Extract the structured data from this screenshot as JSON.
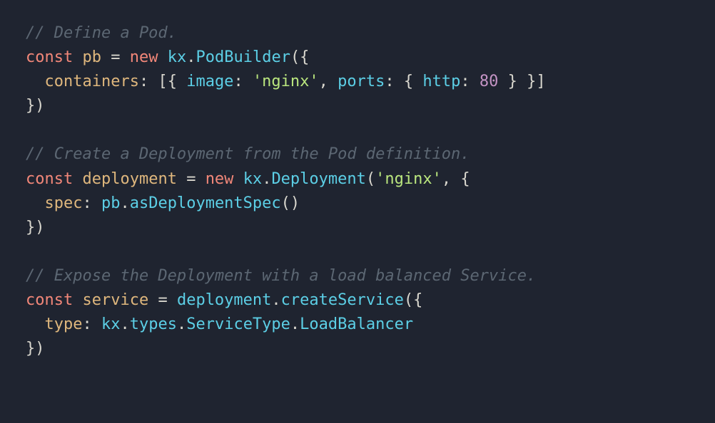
{
  "code": {
    "lines": [
      {
        "indent": 0,
        "tokens": [
          {
            "t": "// Define a Pod.",
            "c": "comment"
          }
        ]
      },
      {
        "indent": 0,
        "tokens": [
          {
            "t": "const",
            "c": "keyword"
          },
          {
            "t": " ",
            "c": "plain"
          },
          {
            "t": "pb",
            "c": "varname"
          },
          {
            "t": " ",
            "c": "plain"
          },
          {
            "t": "=",
            "c": "punct"
          },
          {
            "t": " ",
            "c": "plain"
          },
          {
            "t": "new",
            "c": "keyword"
          },
          {
            "t": " ",
            "c": "plain"
          },
          {
            "t": "kx",
            "c": "ident"
          },
          {
            "t": ".",
            "c": "punct"
          },
          {
            "t": "PodBuilder",
            "c": "ident"
          },
          {
            "t": "({",
            "c": "punct"
          }
        ]
      },
      {
        "indent": 2,
        "tokens": [
          {
            "t": "containers",
            "c": "varname"
          },
          {
            "t": ":",
            "c": "punct"
          },
          {
            "t": " ",
            "c": "plain"
          },
          {
            "t": "[{",
            "c": "punct"
          },
          {
            "t": " ",
            "c": "plain"
          },
          {
            "t": "image",
            "c": "ident"
          },
          {
            "t": ":",
            "c": "punct"
          },
          {
            "t": " ",
            "c": "plain"
          },
          {
            "t": "'nginx'",
            "c": "string"
          },
          {
            "t": ",",
            "c": "punct"
          },
          {
            "t": " ",
            "c": "plain"
          },
          {
            "t": "ports",
            "c": "ident"
          },
          {
            "t": ":",
            "c": "punct"
          },
          {
            "t": " ",
            "c": "plain"
          },
          {
            "t": "{",
            "c": "punct"
          },
          {
            "t": " ",
            "c": "plain"
          },
          {
            "t": "http",
            "c": "ident"
          },
          {
            "t": ":",
            "c": "punct"
          },
          {
            "t": " ",
            "c": "plain"
          },
          {
            "t": "80",
            "c": "number"
          },
          {
            "t": " ",
            "c": "plain"
          },
          {
            "t": "}",
            "c": "punct"
          },
          {
            "t": " ",
            "c": "plain"
          },
          {
            "t": "}]",
            "c": "punct"
          }
        ]
      },
      {
        "indent": 0,
        "tokens": [
          {
            "t": "})",
            "c": "punct"
          }
        ]
      },
      {
        "indent": 0,
        "tokens": [
          {
            "t": "",
            "c": "plain"
          }
        ]
      },
      {
        "indent": 0,
        "tokens": [
          {
            "t": "// Create a Deployment from the Pod definition.",
            "c": "comment"
          }
        ]
      },
      {
        "indent": 0,
        "tokens": [
          {
            "t": "const",
            "c": "keyword"
          },
          {
            "t": " ",
            "c": "plain"
          },
          {
            "t": "deployment",
            "c": "varname"
          },
          {
            "t": " ",
            "c": "plain"
          },
          {
            "t": "=",
            "c": "punct"
          },
          {
            "t": " ",
            "c": "plain"
          },
          {
            "t": "new",
            "c": "keyword"
          },
          {
            "t": " ",
            "c": "plain"
          },
          {
            "t": "kx",
            "c": "ident"
          },
          {
            "t": ".",
            "c": "punct"
          },
          {
            "t": "Deployment",
            "c": "ident"
          },
          {
            "t": "(",
            "c": "punct"
          },
          {
            "t": "'nginx'",
            "c": "string"
          },
          {
            "t": ",",
            "c": "punct"
          },
          {
            "t": " ",
            "c": "plain"
          },
          {
            "t": "{",
            "c": "punct"
          }
        ]
      },
      {
        "indent": 2,
        "tokens": [
          {
            "t": "spec",
            "c": "varname"
          },
          {
            "t": ":",
            "c": "punct"
          },
          {
            "t": " ",
            "c": "plain"
          },
          {
            "t": "pb",
            "c": "ident"
          },
          {
            "t": ".",
            "c": "punct"
          },
          {
            "t": "asDeploymentSpec",
            "c": "ident"
          },
          {
            "t": "()",
            "c": "punct"
          }
        ]
      },
      {
        "indent": 0,
        "tokens": [
          {
            "t": "})",
            "c": "punct"
          }
        ]
      },
      {
        "indent": 0,
        "tokens": [
          {
            "t": "",
            "c": "plain"
          }
        ]
      },
      {
        "indent": 0,
        "tokens": [
          {
            "t": "// Expose the Deployment with a load balanced Service.",
            "c": "comment"
          }
        ]
      },
      {
        "indent": 0,
        "tokens": [
          {
            "t": "const",
            "c": "keyword"
          },
          {
            "t": " ",
            "c": "plain"
          },
          {
            "t": "service",
            "c": "varname"
          },
          {
            "t": " ",
            "c": "plain"
          },
          {
            "t": "=",
            "c": "punct"
          },
          {
            "t": " ",
            "c": "plain"
          },
          {
            "t": "deployment",
            "c": "ident"
          },
          {
            "t": ".",
            "c": "punct"
          },
          {
            "t": "createService",
            "c": "ident"
          },
          {
            "t": "({",
            "c": "punct"
          }
        ]
      },
      {
        "indent": 2,
        "tokens": [
          {
            "t": "type",
            "c": "varname"
          },
          {
            "t": ":",
            "c": "punct"
          },
          {
            "t": " ",
            "c": "plain"
          },
          {
            "t": "kx",
            "c": "ident"
          },
          {
            "t": ".",
            "c": "punct"
          },
          {
            "t": "types",
            "c": "ident"
          },
          {
            "t": ".",
            "c": "punct"
          },
          {
            "t": "ServiceType",
            "c": "ident"
          },
          {
            "t": ".",
            "c": "punct"
          },
          {
            "t": "LoadBalancer",
            "c": "ident"
          }
        ]
      },
      {
        "indent": 0,
        "tokens": [
          {
            "t": "})",
            "c": "punct"
          }
        ]
      }
    ]
  }
}
